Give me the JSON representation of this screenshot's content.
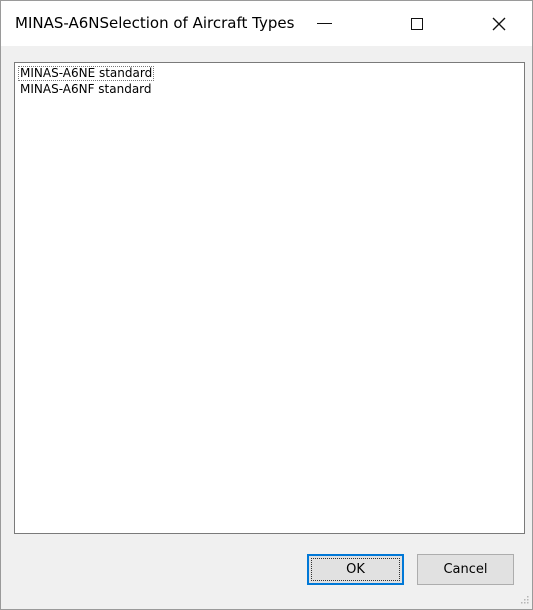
{
  "window": {
    "title": "MINAS-A6NSelection of Aircraft Types"
  },
  "list": {
    "items": [
      {
        "label": "MINAS-A6NE standard"
      },
      {
        "label": "MINAS-A6NF standard"
      }
    ]
  },
  "buttons": {
    "ok_label": "OK",
    "cancel_label": "Cancel"
  },
  "icons": {
    "minimize": "minimize-icon",
    "maximize": "maximize-icon",
    "close": "close-icon",
    "grip": "resize-grip-icon"
  },
  "colors": {
    "accent": "#0078d7",
    "dialog_bg": "#f0f0f0",
    "button_bg": "#e1e1e1"
  }
}
